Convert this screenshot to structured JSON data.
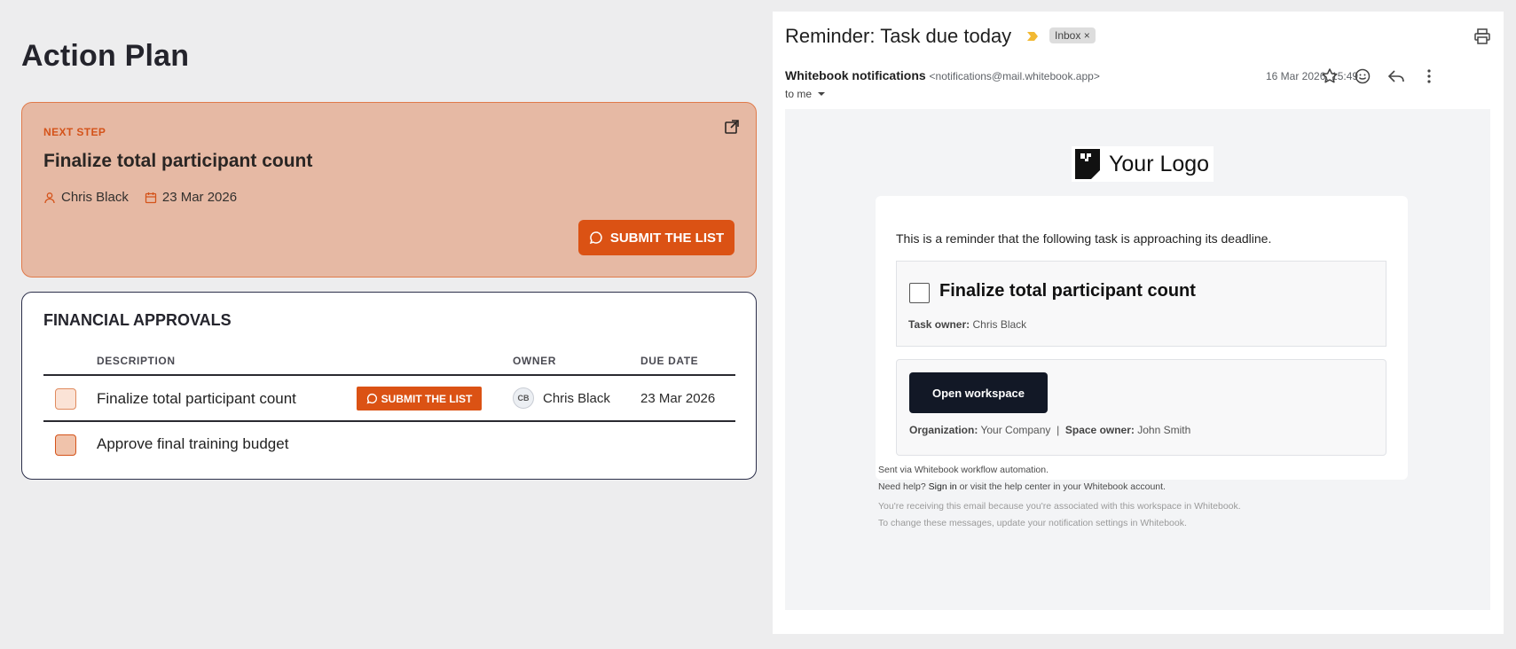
{
  "action_plan": {
    "title": "Action Plan",
    "next_step": {
      "label": "NEXT STEP",
      "task_title": "Finalize total participant count",
      "owner": "Chris Black",
      "due_date": "23 Mar 2026",
      "submit_label": "SUBMIT THE LIST",
      "accent_color": "#db5214",
      "card_color": "#e6b9a4"
    },
    "financial_approvals": {
      "title": "FINANCIAL APPROVALS",
      "columns": {
        "description": "DESCRIPTION",
        "owner": "OWNER",
        "due_date": "DUE DATE"
      },
      "rows": [
        {
          "description": "Finalize total participant count",
          "action_label": "SUBMIT THE LIST",
          "owner_initials": "CB",
          "owner": "Chris Black",
          "due_date": "23 Mar 2026"
        },
        {
          "description": "Approve final training budget",
          "action_label": "",
          "owner_initials": "",
          "owner": "",
          "due_date": ""
        }
      ]
    }
  },
  "email": {
    "subject": "Reminder: Task due today",
    "label_chip": "Inbox ×",
    "sender_name": "Whitebook notifications",
    "sender_address": "<notifications@mail.whitebook.app>",
    "recipient": "to me",
    "date": "16 Mar 2026, 15:49",
    "actions": [
      "star-icon",
      "emoji-icon",
      "reply-icon",
      "more-icon"
    ],
    "body": {
      "logo_text": "Your Logo",
      "intro": "This is a reminder that the following task is approaching its deadline.",
      "task_title": "Finalize total participant count",
      "task_owner_label": "Task owner:",
      "task_owner": "Chris Black",
      "button_label": "Open workspace",
      "org_label": "Organization:",
      "organization": "Your Company",
      "separator": "|",
      "space_owner_label": "Space owner:",
      "space_owner": "John Smith",
      "footer": {
        "line1": "Sent via Whitebook workflow automation.",
        "line2_prefix": "Need help?",
        "line2_link": "Sign in",
        "line2_suffix": "or visit the help center in your Whitebook account.",
        "line3": "You're receiving this email because you're associated with this workspace in Whitebook.",
        "line4": "To change these messages, update your notification settings in Whitebook."
      }
    }
  }
}
